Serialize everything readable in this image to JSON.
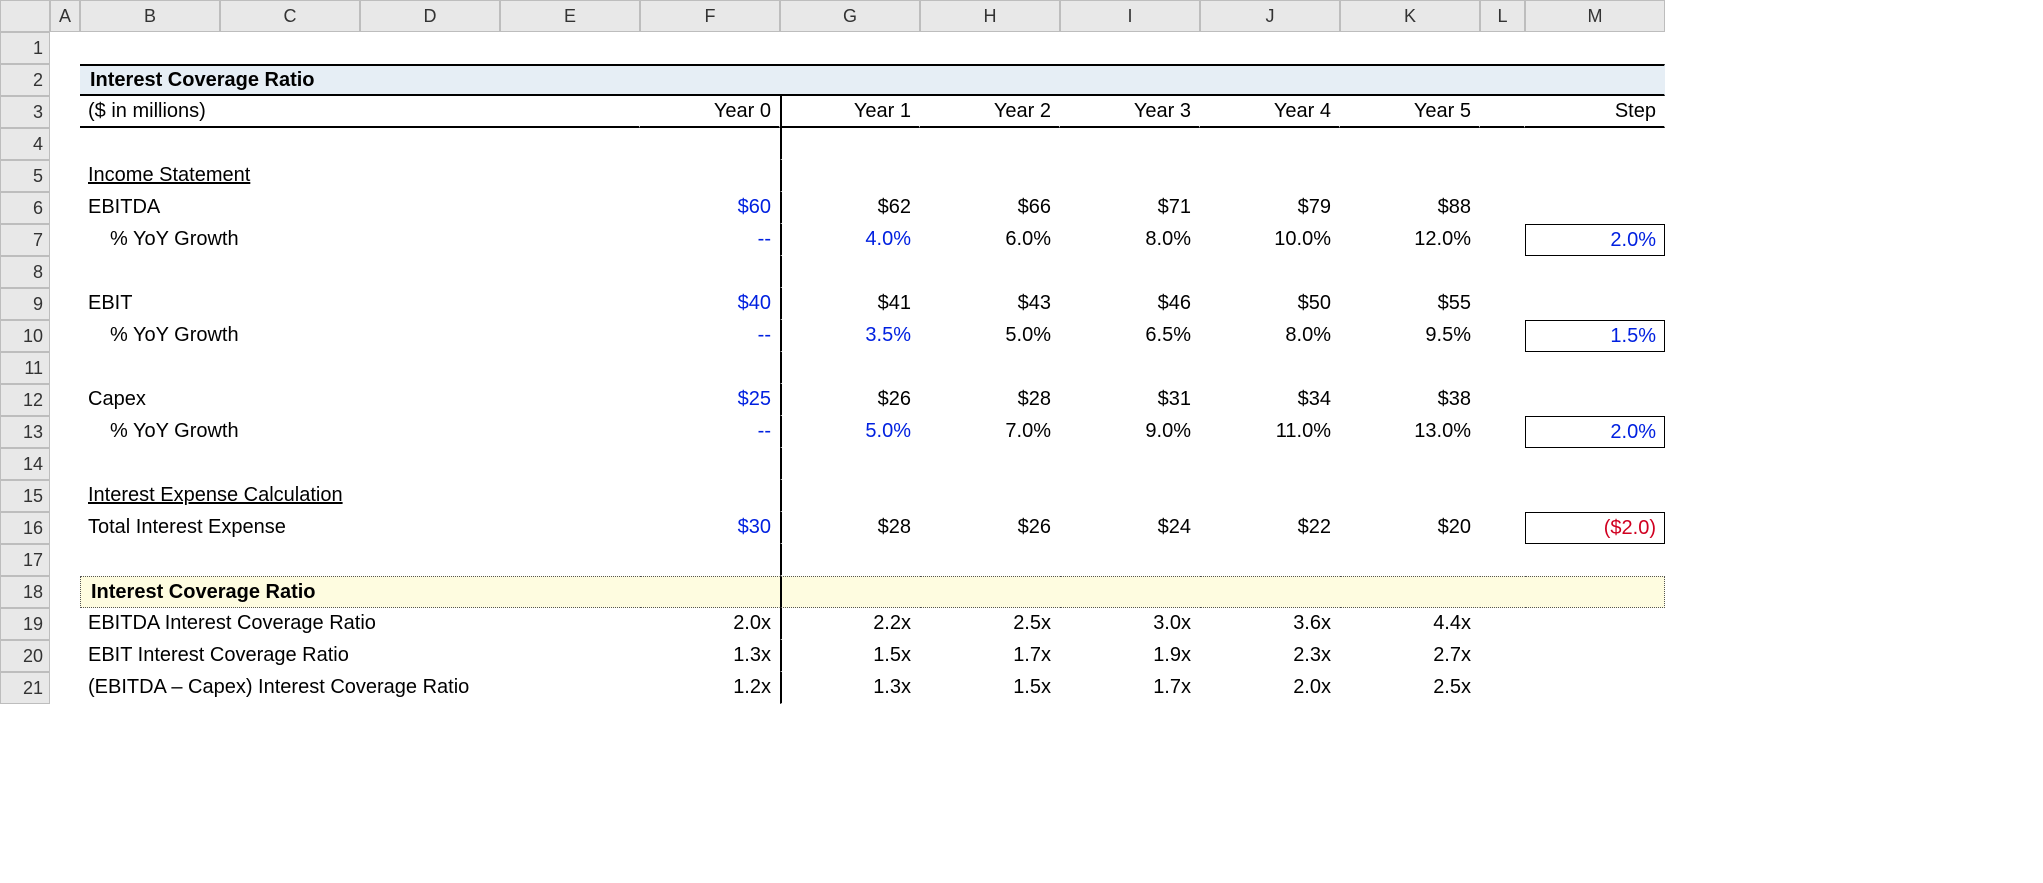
{
  "columns": [
    "A",
    "B",
    "C",
    "D",
    "E",
    "F",
    "G",
    "H",
    "I",
    "J",
    "K",
    "L",
    "M"
  ],
  "rows": [
    "1",
    "2",
    "3",
    "4",
    "5",
    "6",
    "7",
    "8",
    "9",
    "10",
    "11",
    "12",
    "13",
    "14",
    "15",
    "16",
    "17",
    "18",
    "19",
    "20",
    "21"
  ],
  "title": "Interest Coverage Ratio",
  "units": "($ in millions)",
  "year_labels": {
    "F": "Year 0",
    "G": "Year 1",
    "H": "Year 2",
    "I": "Year 3",
    "J": "Year 4",
    "K": "Year 5",
    "M": "Step"
  },
  "sections": {
    "income": "Income Statement",
    "interest": "Interest Expense Calculation",
    "ratio": "Interest Coverage Ratio"
  },
  "lines": {
    "ebitda": {
      "label": "EBITDA",
      "F": "$60",
      "G": "$62",
      "H": "$66",
      "I": "$71",
      "J": "$79",
      "K": "$88"
    },
    "ebitda_g": {
      "label": "% YoY Growth",
      "F": "--",
      "G": "4.0%",
      "H": "6.0%",
      "I": "8.0%",
      "J": "10.0%",
      "K": "12.0%",
      "M": "2.0%"
    },
    "ebit": {
      "label": "EBIT",
      "F": "$40",
      "G": "$41",
      "H": "$43",
      "I": "$46",
      "J": "$50",
      "K": "$55"
    },
    "ebit_g": {
      "label": "% YoY Growth",
      "F": "--",
      "G": "3.5%",
      "H": "5.0%",
      "I": "6.5%",
      "J": "8.0%",
      "K": "9.5%",
      "M": "1.5%"
    },
    "capex": {
      "label": "Capex",
      "F": "$25",
      "G": "$26",
      "H": "$28",
      "I": "$31",
      "J": "$34",
      "K": "$38"
    },
    "capex_g": {
      "label": "% YoY Growth",
      "F": "--",
      "G": "5.0%",
      "H": "7.0%",
      "I": "9.0%",
      "J": "11.0%",
      "K": "13.0%",
      "M": "2.0%"
    },
    "intexp": {
      "label": "Total Interest Expense",
      "F": "$30",
      "G": "$28",
      "H": "$26",
      "I": "$24",
      "J": "$22",
      "K": "$20",
      "M": "($2.0)"
    },
    "r_ebitda": {
      "label": "EBITDA Interest Coverage Ratio",
      "F": "2.0x",
      "G": "2.2x",
      "H": "2.5x",
      "I": "3.0x",
      "J": "3.6x",
      "K": "4.4x"
    },
    "r_ebit": {
      "label": "EBIT Interest Coverage Ratio",
      "F": "1.3x",
      "G": "1.5x",
      "H": "1.7x",
      "I": "1.9x",
      "J": "2.3x",
      "K": "2.7x"
    },
    "r_ec": {
      "label": "(EBITDA – Capex) Interest Coverage Ratio",
      "F": "1.2x",
      "G": "1.3x",
      "H": "1.5x",
      "I": "1.7x",
      "J": "2.0x",
      "K": "2.5x"
    }
  }
}
